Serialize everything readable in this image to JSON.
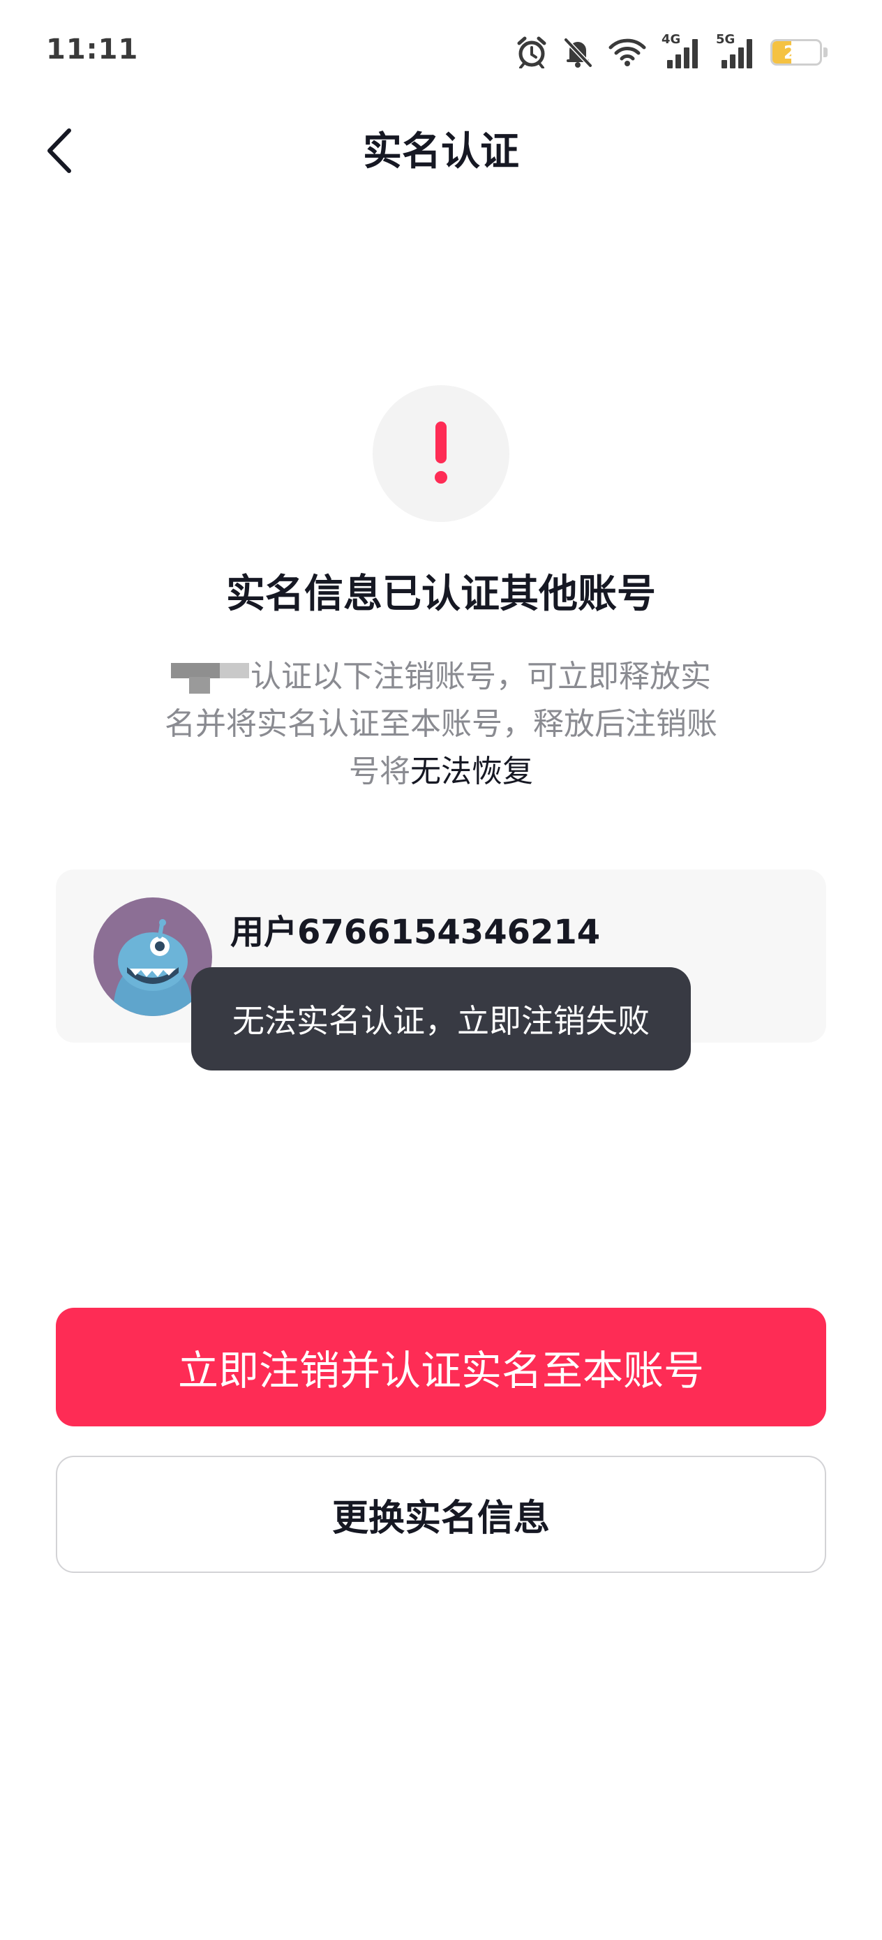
{
  "status_bar": {
    "time": "11:11",
    "network_4g_label": "4G",
    "network_5g_label": "5G",
    "battery_level": "22",
    "icons": [
      "alarm-icon",
      "bell-off-icon",
      "wifi-icon",
      "signal-4g-icon",
      "signal-5g-icon",
      "battery-icon"
    ]
  },
  "nav": {
    "back_icon": "chevron-left-icon",
    "title": "实名认证"
  },
  "warning": {
    "icon": "exclamation-icon",
    "accent_color": "#fe2c55",
    "headline": "实名信息已认证其他账号",
    "desc_part1": "认证以下注销账号，可立即释放实名并将实名认证至本账号，释放后注销账号将",
    "desc_emphasis": "无法恢复"
  },
  "account": {
    "name": "用户6766154346214"
  },
  "toast": {
    "message": "无法实名认证，立即注销失败"
  },
  "actions": {
    "primary_label": "立即注销并认证实名至本账号",
    "primary_color": "#fe2c55",
    "secondary_label": "更换实名信息"
  }
}
